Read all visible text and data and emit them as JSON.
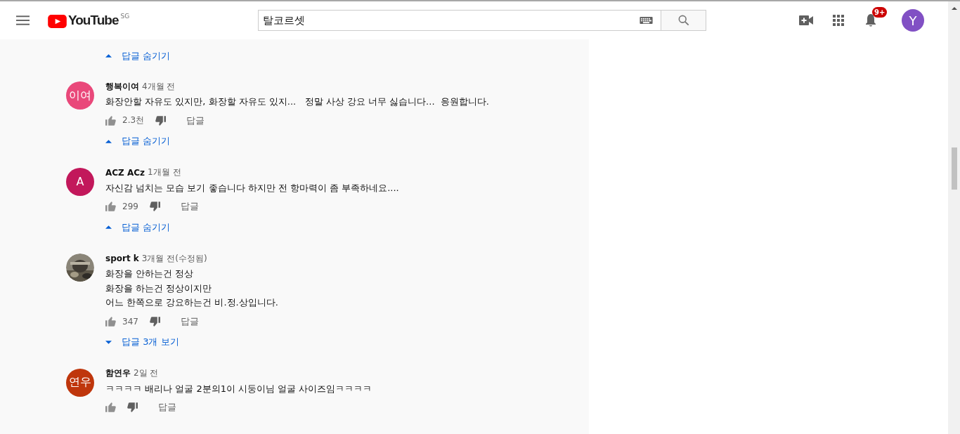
{
  "header": {
    "logo_text": "YouTube",
    "region": "SG",
    "search": {
      "value": "탈코르셋"
    },
    "notifications_badge": "9+",
    "account_initial": "Y"
  },
  "top_reply_toggle": {
    "label": "답글 숨기기",
    "expanded": true
  },
  "comments": [
    {
      "author": "행복이여",
      "time": "4개월 전",
      "avatar": {
        "kind": "letters",
        "text": "이여",
        "color": "#e9487a"
      },
      "lines": [
        "화장안할 자유도 있지만, 화장할 자유도 있지...   정말 사상 강요 너무 싫습니다...  응원합니다."
      ],
      "likes": "2.3천",
      "reply_label": "답글",
      "replies": {
        "label": "답글 숨기기",
        "expanded": true
      }
    },
    {
      "author": "ACZ ACz",
      "time": "1개월 전",
      "avatar": {
        "kind": "letters",
        "text": "A",
        "color": "#c2185b"
      },
      "lines": [
        "자신감 넘치는 모습 보기 좋습니다 하지만 전 항마력이 좀 부족하네요...."
      ],
      "likes": "299",
      "reply_label": "답글",
      "replies": {
        "label": "답글 숨기기",
        "expanded": true
      }
    },
    {
      "author": "sport k",
      "time": "3개월 전(수정됨)",
      "avatar": {
        "kind": "picture"
      },
      "lines": [
        "화장을 안하는건 정상",
        "화장을 하는건 정상이지만",
        "어느 한쪽으로 강요하는건 비.정.상입니다."
      ],
      "likes": "347",
      "reply_label": "답글",
      "replies": {
        "label": "답글 3개 보기",
        "expanded": false
      }
    },
    {
      "author": "함연우",
      "time": "2일 전",
      "avatar": {
        "kind": "letters",
        "text": "연우",
        "color": "#bf360c"
      },
      "lines": [
        "ㅋㅋㅋㅋ 배리나 얼굴 2분의1이 시둥이님 얼굴 사이즈임ㅋㅋㅋㅋ"
      ],
      "reply_label": "답글"
    }
  ]
}
